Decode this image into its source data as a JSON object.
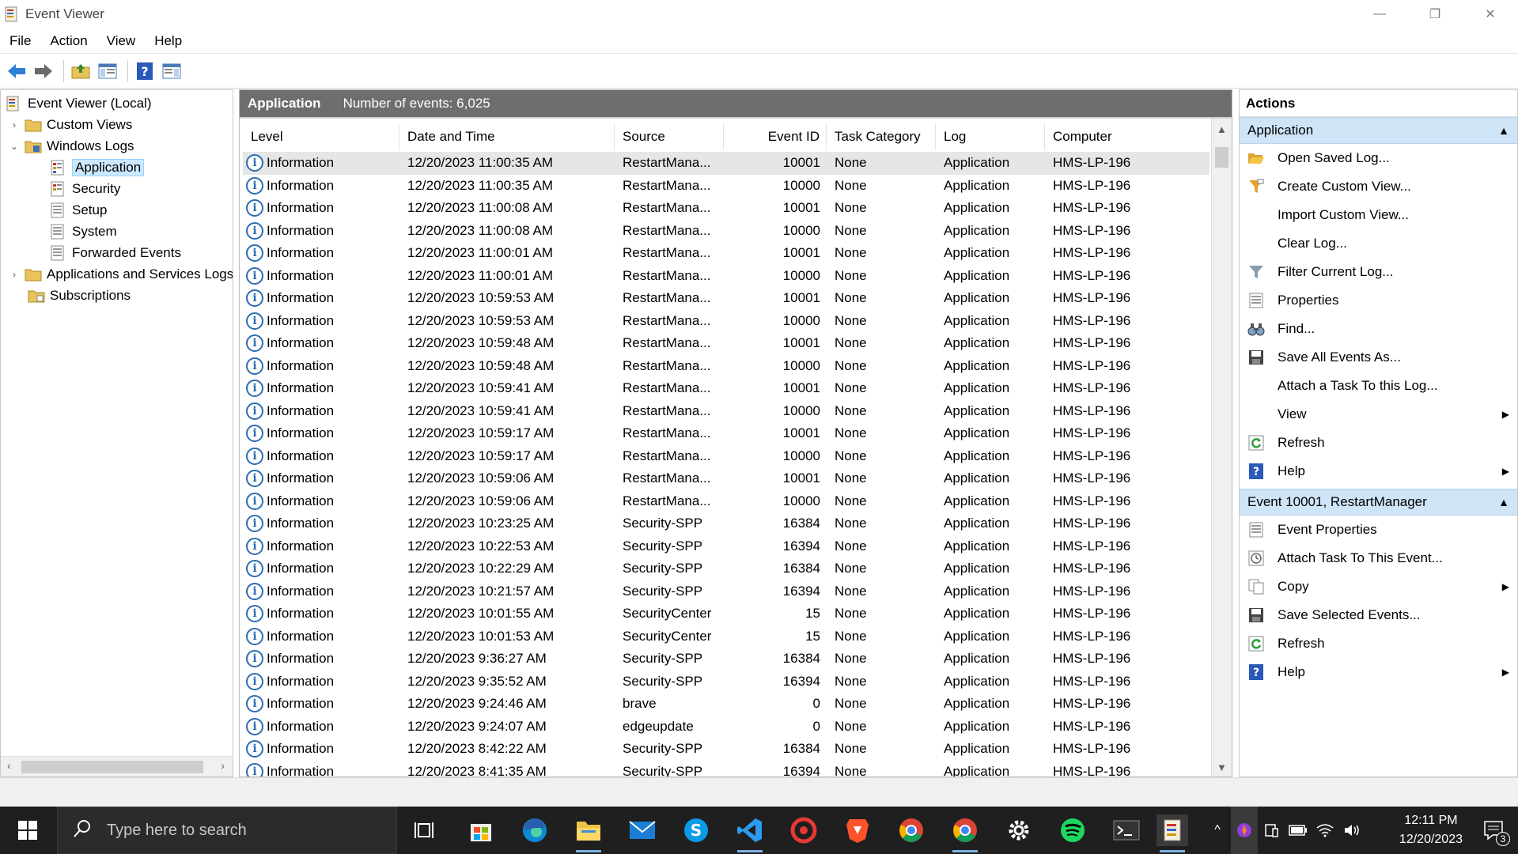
{
  "window": {
    "title": "Event Viewer",
    "controls": {
      "minimize": "—",
      "restore": "❐",
      "close": "✕"
    }
  },
  "menu": [
    "File",
    "Action",
    "View",
    "Help"
  ],
  "tree": {
    "root": "Event Viewer (Local)",
    "custom_views": "Custom Views",
    "windows_logs": "Windows Logs",
    "application": "Application",
    "security": "Security",
    "setup": "Setup",
    "system": "System",
    "forwarded": "Forwarded Events",
    "apps_services": "Applications and Services Logs",
    "subscriptions": "Subscriptions"
  },
  "center": {
    "title": "Application",
    "count": "Number of events: 6,025",
    "columns": [
      "Level",
      "Date and Time",
      "Source",
      "Event ID",
      "Task Category",
      "Log",
      "Computer"
    ],
    "rows": [
      [
        "Information",
        "12/20/2023 11:00:35 AM",
        "RestartMana...",
        "10001",
        "None",
        "Application",
        "HMS-LP-196"
      ],
      [
        "Information",
        "12/20/2023 11:00:35 AM",
        "RestartMana...",
        "10000",
        "None",
        "Application",
        "HMS-LP-196"
      ],
      [
        "Information",
        "12/20/2023 11:00:08 AM",
        "RestartMana...",
        "10001",
        "None",
        "Application",
        "HMS-LP-196"
      ],
      [
        "Information",
        "12/20/2023 11:00:08 AM",
        "RestartMana...",
        "10000",
        "None",
        "Application",
        "HMS-LP-196"
      ],
      [
        "Information",
        "12/20/2023 11:00:01 AM",
        "RestartMana...",
        "10001",
        "None",
        "Application",
        "HMS-LP-196"
      ],
      [
        "Information",
        "12/20/2023 11:00:01 AM",
        "RestartMana...",
        "10000",
        "None",
        "Application",
        "HMS-LP-196"
      ],
      [
        "Information",
        "12/20/2023 10:59:53 AM",
        "RestartMana...",
        "10001",
        "None",
        "Application",
        "HMS-LP-196"
      ],
      [
        "Information",
        "12/20/2023 10:59:53 AM",
        "RestartMana...",
        "10000",
        "None",
        "Application",
        "HMS-LP-196"
      ],
      [
        "Information",
        "12/20/2023 10:59:48 AM",
        "RestartMana...",
        "10001",
        "None",
        "Application",
        "HMS-LP-196"
      ],
      [
        "Information",
        "12/20/2023 10:59:48 AM",
        "RestartMana...",
        "10000",
        "None",
        "Application",
        "HMS-LP-196"
      ],
      [
        "Information",
        "12/20/2023 10:59:41 AM",
        "RestartMana...",
        "10001",
        "None",
        "Application",
        "HMS-LP-196"
      ],
      [
        "Information",
        "12/20/2023 10:59:41 AM",
        "RestartMana...",
        "10000",
        "None",
        "Application",
        "HMS-LP-196"
      ],
      [
        "Information",
        "12/20/2023 10:59:17 AM",
        "RestartMana...",
        "10001",
        "None",
        "Application",
        "HMS-LP-196"
      ],
      [
        "Information",
        "12/20/2023 10:59:17 AM",
        "RestartMana...",
        "10000",
        "None",
        "Application",
        "HMS-LP-196"
      ],
      [
        "Information",
        "12/20/2023 10:59:06 AM",
        "RestartMana...",
        "10001",
        "None",
        "Application",
        "HMS-LP-196"
      ],
      [
        "Information",
        "12/20/2023 10:59:06 AM",
        "RestartMana...",
        "10000",
        "None",
        "Application",
        "HMS-LP-196"
      ],
      [
        "Information",
        "12/20/2023 10:23:25 AM",
        "Security-SPP",
        "16384",
        "None",
        "Application",
        "HMS-LP-196"
      ],
      [
        "Information",
        "12/20/2023 10:22:53 AM",
        "Security-SPP",
        "16394",
        "None",
        "Application",
        "HMS-LP-196"
      ],
      [
        "Information",
        "12/20/2023 10:22:29 AM",
        "Security-SPP",
        "16384",
        "None",
        "Application",
        "HMS-LP-196"
      ],
      [
        "Information",
        "12/20/2023 10:21:57 AM",
        "Security-SPP",
        "16394",
        "None",
        "Application",
        "HMS-LP-196"
      ],
      [
        "Information",
        "12/20/2023 10:01:55 AM",
        "SecurityCenter",
        "15",
        "None",
        "Application",
        "HMS-LP-196"
      ],
      [
        "Information",
        "12/20/2023 10:01:53 AM",
        "SecurityCenter",
        "15",
        "None",
        "Application",
        "HMS-LP-196"
      ],
      [
        "Information",
        "12/20/2023 9:36:27 AM",
        "Security-SPP",
        "16384",
        "None",
        "Application",
        "HMS-LP-196"
      ],
      [
        "Information",
        "12/20/2023 9:35:52 AM",
        "Security-SPP",
        "16394",
        "None",
        "Application",
        "HMS-LP-196"
      ],
      [
        "Information",
        "12/20/2023 9:24:46 AM",
        "brave",
        "0",
        "None",
        "Application",
        "HMS-LP-196"
      ],
      [
        "Information",
        "12/20/2023 9:24:07 AM",
        "edgeupdate",
        "0",
        "None",
        "Application",
        "HMS-LP-196"
      ],
      [
        "Information",
        "12/20/2023 8:42:22 AM",
        "Security-SPP",
        "16384",
        "None",
        "Application",
        "HMS-LP-196"
      ],
      [
        "Information",
        "12/20/2023 8:41:35 AM",
        "Security-SPP",
        "16394",
        "None",
        "Application",
        "HMS-LP-196"
      ]
    ]
  },
  "actions": {
    "title": "Actions",
    "section1": {
      "header": "Application",
      "items": [
        {
          "label": "Open Saved Log...",
          "icon": "folder-open-icon"
        },
        {
          "label": "Create Custom View...",
          "icon": "funnel-icon"
        },
        {
          "label": "Import Custom View...",
          "icon": ""
        },
        {
          "label": "Clear Log...",
          "icon": ""
        },
        {
          "label": "Filter Current Log...",
          "icon": "filter-icon"
        },
        {
          "label": "Properties",
          "icon": "properties-icon"
        },
        {
          "label": "Find...",
          "icon": "binoculars-icon"
        },
        {
          "label": "Save All Events As...",
          "icon": "save-icon"
        },
        {
          "label": "Attach a Task To this Log...",
          "icon": ""
        },
        {
          "label": "View",
          "icon": "",
          "submenu": true
        },
        {
          "label": "Refresh",
          "icon": "refresh-icon"
        },
        {
          "label": "Help",
          "icon": "help-icon",
          "submenu": true
        }
      ]
    },
    "section2": {
      "header": "Event 10001, RestartManager",
      "items": [
        {
          "label": "Event Properties",
          "icon": "properties-icon"
        },
        {
          "label": "Attach Task To This Event...",
          "icon": "task-icon"
        },
        {
          "label": "Copy",
          "icon": "copy-icon",
          "submenu": true
        },
        {
          "label": "Save Selected Events...",
          "icon": "save-icon"
        },
        {
          "label": "Refresh",
          "icon": "refresh-icon"
        },
        {
          "label": "Help",
          "icon": "help-icon",
          "submenu": true
        }
      ]
    }
  },
  "taskbar": {
    "search_placeholder": "Type here to search",
    "time": "12:11 PM",
    "date": "12/20/2023",
    "notifications": "3"
  }
}
